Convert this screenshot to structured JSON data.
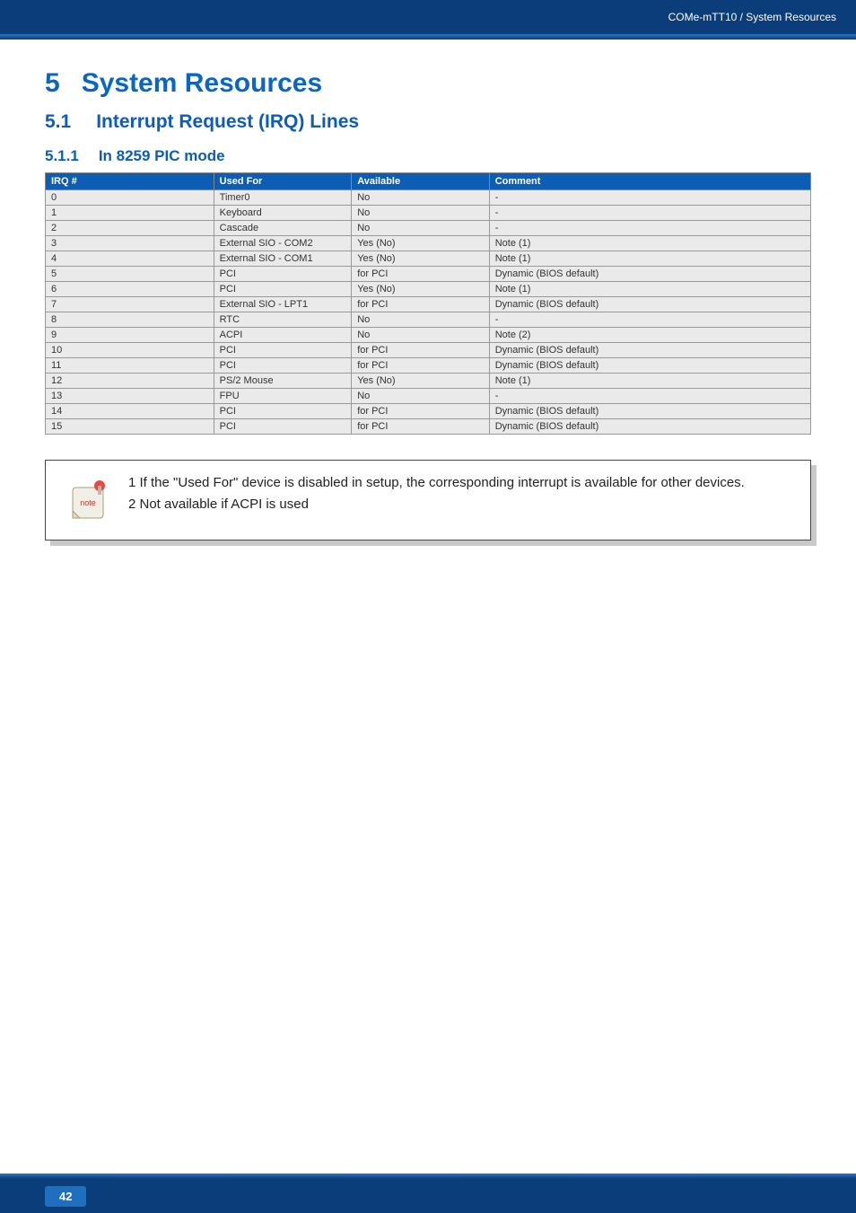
{
  "header": {
    "breadcrumb": "COMe-mTT10 / System Resources"
  },
  "chapter": {
    "number": "5",
    "title": "System Resources"
  },
  "section": {
    "number": "5.1",
    "title": "Interrupt Request (IRQ) Lines"
  },
  "subsection": {
    "number": "5.1.1",
    "title": "In 8259 PIC mode"
  },
  "table": {
    "headers": {
      "c1": "IRQ #",
      "c2": "Used For",
      "c3": "Available",
      "c4": "Comment"
    },
    "rows": [
      {
        "irq": "0",
        "used": "Timer0",
        "avail": "No",
        "comment": "-"
      },
      {
        "irq": "1",
        "used": "Keyboard",
        "avail": "No",
        "comment": "-"
      },
      {
        "irq": "2",
        "used": "Cascade",
        "avail": "No",
        "comment": "-"
      },
      {
        "irq": "3",
        "used": "External SIO - COM2",
        "avail": "Yes (No)",
        "comment": "Note (1)"
      },
      {
        "irq": "4",
        "used": "External SIO - COM1",
        "avail": "Yes (No)",
        "comment": "Note (1)"
      },
      {
        "irq": "5",
        "used": "PCI",
        "avail": "for PCI",
        "comment": "Dynamic (BIOS default)"
      },
      {
        "irq": "6",
        "used": "PCI",
        "avail": "Yes (No)",
        "comment": "Note (1)"
      },
      {
        "irq": "7",
        "used": "External SIO - LPT1",
        "avail": "for PCI",
        "comment": "Dynamic (BIOS default)"
      },
      {
        "irq": "8",
        "used": "RTC",
        "avail": "No",
        "comment": "-"
      },
      {
        "irq": "9",
        "used": "ACPI",
        "avail": "No",
        "comment": "Note (2)"
      },
      {
        "irq": "10",
        "used": "PCI",
        "avail": "for PCI",
        "comment": "Dynamic (BIOS default)"
      },
      {
        "irq": "11",
        "used": "PCI",
        "avail": "for PCI",
        "comment": "Dynamic (BIOS default)"
      },
      {
        "irq": "12",
        "used": "PS/2 Mouse",
        "avail": "Yes (No)",
        "comment": "Note (1)"
      },
      {
        "irq": "13",
        "used": "FPU",
        "avail": "No",
        "comment": "-"
      },
      {
        "irq": "14",
        "used": "PCI",
        "avail": "for PCI",
        "comment": "Dynamic (BIOS default)"
      },
      {
        "irq": "15",
        "used": "PCI",
        "avail": "for PCI",
        "comment": "Dynamic (BIOS default)"
      }
    ]
  },
  "note": {
    "line1": "1 If the \"Used For\" device is disabled in setup, the corresponding interrupt is available for other devices.",
    "line2": "2 Not available if ACPI is used",
    "icon_label": "note"
  },
  "footer": {
    "page": "42"
  }
}
